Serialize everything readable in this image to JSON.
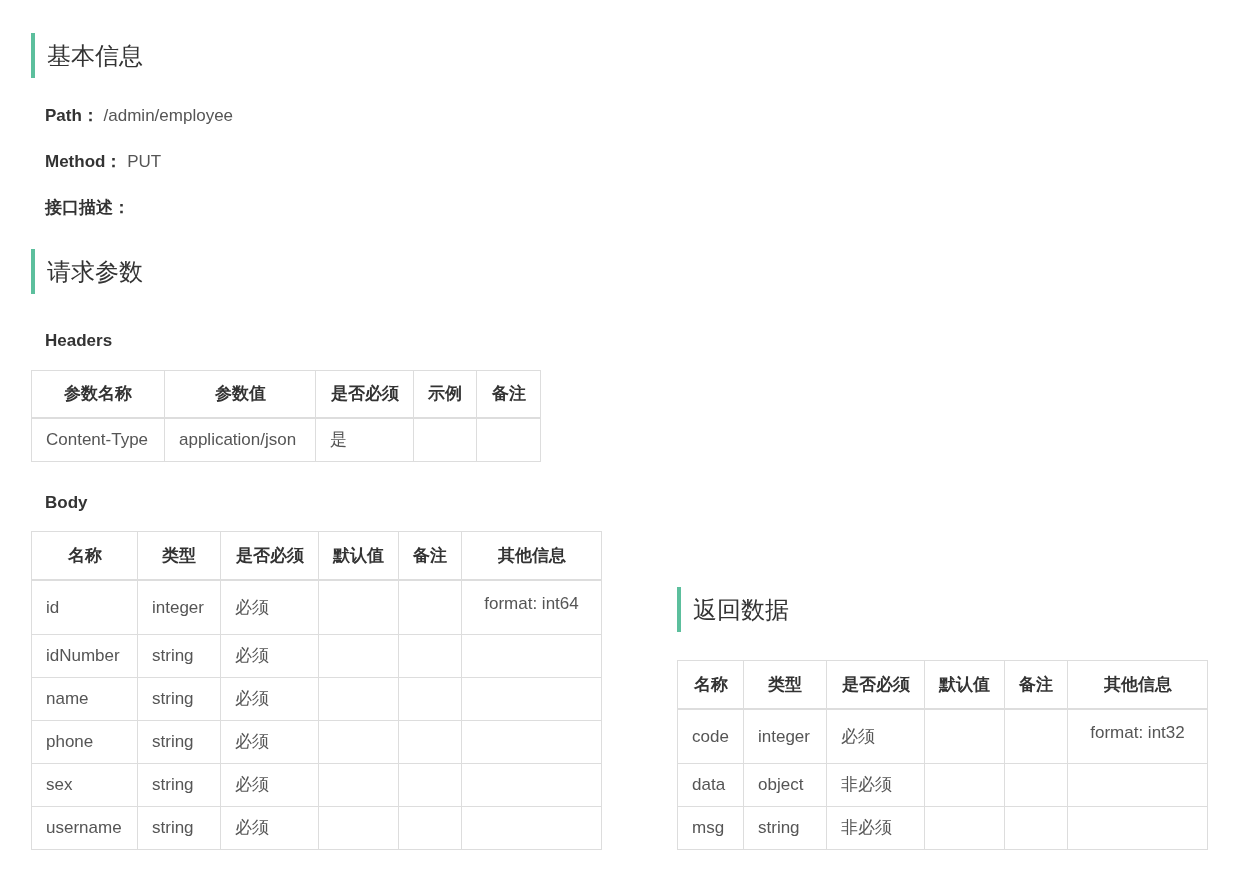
{
  "basic_info": {
    "title": "基本信息",
    "fields": [
      {
        "label": "Path：",
        "value": "/admin/employee"
      },
      {
        "label": "Method：",
        "value": "PUT"
      },
      {
        "label": "接口描述："
      }
    ]
  },
  "request_params": {
    "title": "请求参数",
    "headers": {
      "title": "Headers",
      "columns": [
        "参数名称",
        "参数值",
        "是否必须",
        "示例",
        "备注"
      ],
      "rows": [
        [
          "Content-Type",
          "application/json",
          "是",
          null,
          null
        ]
      ]
    },
    "body": {
      "title": "Body",
      "columns": [
        "名称",
        "类型",
        "是否必须",
        "默认值",
        "备注",
        "其他信息"
      ],
      "rows": [
        [
          "id",
          "integer",
          "必须",
          null,
          null,
          "format: int64"
        ],
        [
          "idNumber",
          "string",
          "必须",
          null,
          null,
          null
        ],
        [
          "name",
          "string",
          "必须",
          null,
          null,
          null
        ],
        [
          "phone",
          "string",
          "必须",
          null,
          null,
          null
        ],
        [
          "sex",
          "string",
          "必须",
          null,
          null,
          null
        ],
        [
          "username",
          "string",
          "必须",
          null,
          null,
          null
        ]
      ]
    }
  },
  "response": {
    "title": "返回数据",
    "table": {
      "columns": [
        "名称",
        "类型",
        "是否必须",
        "默认值",
        "备注",
        "其他信息"
      ],
      "rows": [
        [
          "code",
          "integer",
          "必须",
          null,
          null,
          "format: int32"
        ],
        [
          "data",
          "object",
          "非必须",
          null,
          null,
          null
        ],
        [
          "msg",
          "string",
          "非必须",
          null,
          null,
          null
        ]
      ]
    }
  }
}
